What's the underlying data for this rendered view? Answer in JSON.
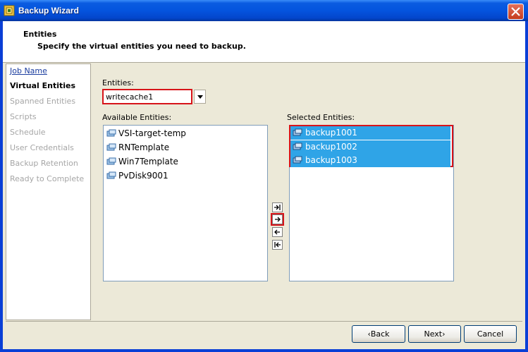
{
  "window": {
    "title": "Backup Wizard"
  },
  "header": {
    "title": "Entities",
    "subtitle": "Specify the virtual entities you need to backup."
  },
  "nav": {
    "items": [
      {
        "label": "Job Name"
      },
      {
        "label": "Virtual Entities"
      },
      {
        "label": "Spanned Entities"
      },
      {
        "label": "Scripts"
      },
      {
        "label": "Schedule"
      },
      {
        "label": "User Credentials"
      },
      {
        "label": "Backup Retention"
      },
      {
        "label": "Ready to Complete"
      }
    ]
  },
  "entities": {
    "label": "Entities:",
    "value": "writecache1"
  },
  "available": {
    "label": "Available Entities:",
    "items": [
      "VSI-target-temp",
      "RNTemplate",
      "Win7Template",
      "PvDisk9001"
    ]
  },
  "selected": {
    "label": "Selected Entities:",
    "items": [
      "backup1001",
      "backup1002",
      "backup1003"
    ]
  },
  "buttons": {
    "back": "‹Back",
    "next": "Next›",
    "cancel": "Cancel"
  },
  "colors": {
    "selection": "#2FA4E7",
    "highlight": "#D7141A",
    "titlebar": "#0454DE"
  }
}
